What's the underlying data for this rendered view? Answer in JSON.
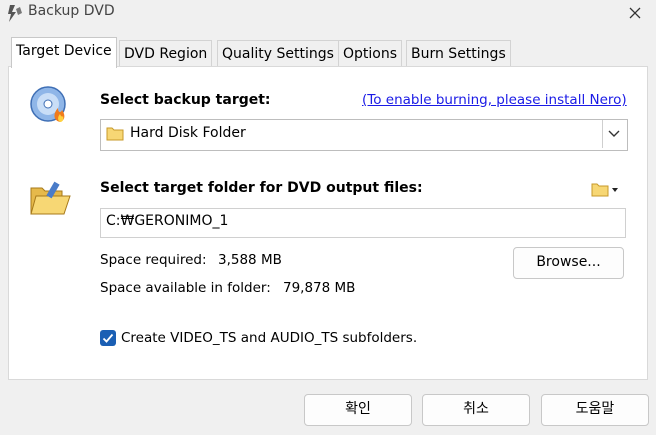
{
  "window": {
    "title": "Backup DVD"
  },
  "icons": {
    "app": "dvd-app-icon",
    "close": "close-icon",
    "disc": "dvd-burn-icon",
    "folder_open": "open-folder-icon",
    "folder": "folder-icon",
    "folder_menu": "folder-dropdown-icon",
    "chevron": "chevron-down-icon",
    "check": "checkmark-icon"
  },
  "tabs": [
    {
      "label": "Target Device",
      "active": true
    },
    {
      "label": "DVD Region",
      "active": false
    },
    {
      "label": "Quality Settings",
      "active": false
    },
    {
      "label": "Options",
      "active": false
    },
    {
      "label": "Burn Settings",
      "active": false
    }
  ],
  "target": {
    "label": "Select backup target:",
    "link": "(To enable burning, please install Nero)",
    "selected": "Hard Disk Folder"
  },
  "folder": {
    "label": "Select target folder for DVD output files:",
    "path": "C:₩GERONIMO_1",
    "browse_label": "Browse...",
    "space_required_label": "Space required:",
    "space_required_value": "3,588 MB",
    "space_available_label": "Space available in folder:",
    "space_available_value": "79,878 MB"
  },
  "subfolders": {
    "checked": true,
    "label": "Create VIDEO_TS and AUDIO_TS subfolders."
  },
  "buttons": {
    "ok": "확인",
    "cancel": "취소",
    "help": "도움말"
  },
  "colors": {
    "accent": "#1a5fb4",
    "link": "#1a1ae6"
  }
}
